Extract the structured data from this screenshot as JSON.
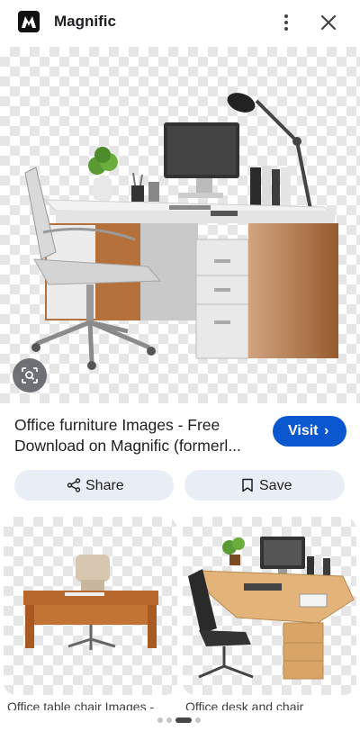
{
  "header": {
    "site_name": "Magnific",
    "logo_icon": "magnific-logo",
    "menu_icon": "more-vert-icon",
    "close_icon": "close-icon"
  },
  "result": {
    "title": "Office furniture Images - Free Download on Magnific (formerl...",
    "visit_label": "Visit",
    "visit_chevron": "›"
  },
  "actions": {
    "share_label": "Share",
    "save_label": "Save"
  },
  "related": [
    {
      "caption": "Office table chair Images -"
    },
    {
      "caption": "Office desk and chair"
    }
  ],
  "pager": {
    "count": 4,
    "active_index": 2
  },
  "colors": {
    "accent": "#0b57d0",
    "pill_bg": "#e9eef6"
  }
}
